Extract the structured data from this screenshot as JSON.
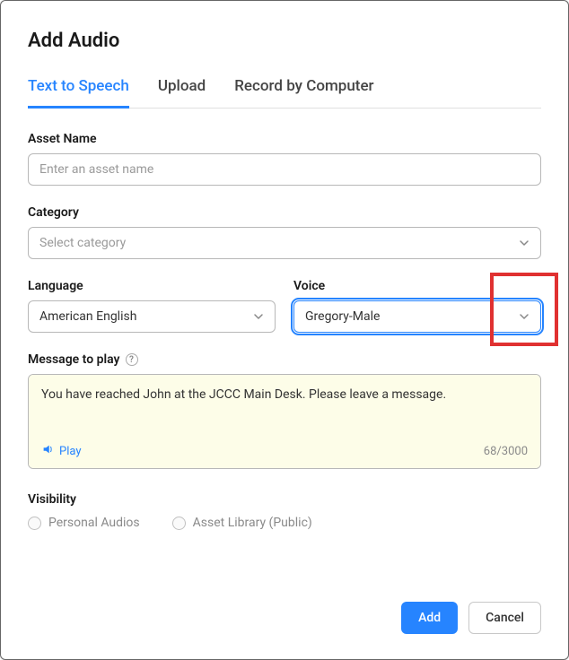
{
  "modal": {
    "title": "Add Audio"
  },
  "tabs": {
    "tts": "Text to Speech",
    "upload": "Upload",
    "record": "Record by Computer"
  },
  "assetName": {
    "label": "Asset Name",
    "placeholder": "Enter an asset name",
    "value": ""
  },
  "category": {
    "label": "Category",
    "placeholder": "Select category",
    "value": ""
  },
  "language": {
    "label": "Language",
    "value": "American English"
  },
  "voice": {
    "label": "Voice",
    "value": "Gregory-Male"
  },
  "message": {
    "label": "Message to play",
    "value": "You have reached John at the JCCC Main Desk. Please leave a message.",
    "playLabel": "Play",
    "counter": "68/3000"
  },
  "visibility": {
    "label": "Visibility",
    "personal": "Personal Audios",
    "library": "Asset Library (Public)"
  },
  "footer": {
    "add": "Add",
    "cancel": "Cancel"
  }
}
